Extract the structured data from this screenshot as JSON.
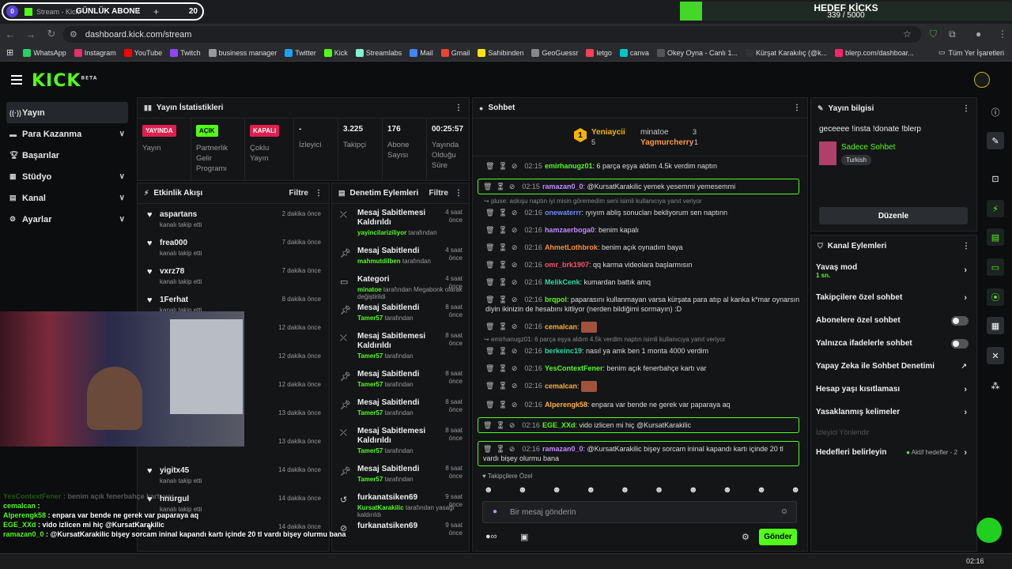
{
  "browser": {
    "tab_counter": "0",
    "tab_title": "Stream - Kick",
    "abone_label": "GÜNLÜK ABONE",
    "abone_count": "20",
    "url": "dashboard.kick.com/stream",
    "goal_title": "HEDEF KİCKS",
    "goal_value": "339 / 5000",
    "goal_progress": 0.0678,
    "bookmarks": [
      "WhatsApp",
      "Instagram",
      "YouTube",
      "Twitch",
      "business manager",
      "Twitter",
      "Kick",
      "Streamlabs",
      "Mail",
      "Gmail",
      "Sahibinden",
      "GeoGuessr",
      "letgo",
      "canva",
      "Okey Oyna - Canlı 1...",
      "Kürşat Karakılıç (@k...",
      "blerp.com/dashboar..."
    ],
    "bookmark_colors": [
      "#25d366",
      "#e1306c",
      "#ff0000",
      "#9146ff",
      "#999999",
      "#1da1f2",
      "#53fc18",
      "#80f5d2",
      "#4285f4",
      "#ea4335",
      "#ffe600",
      "#888888",
      "#ff3f55",
      "#00c4cc",
      "#555555",
      "#333333",
      "#ff2266"
    ],
    "all_bookmarks": "Tüm Yer İşaretleri"
  },
  "brand": {
    "logo": "KICK",
    "beta": "BETA",
    "accent": "#53fc18"
  },
  "sidebar": {
    "items": [
      {
        "label": "Yayın",
        "icon": "broadcast-icon"
      },
      {
        "label": "Para Kazanma",
        "icon": "money-icon"
      },
      {
        "label": "Başarılar",
        "icon": "trophy-icon"
      },
      {
        "label": "Stüdyo",
        "icon": "studio-icon"
      },
      {
        "label": "Kanal",
        "icon": "channel-icon"
      },
      {
        "label": "Ayarlar",
        "icon": "gear-icon"
      }
    ]
  },
  "stats": {
    "title": "Yayın İstatistikleri",
    "cells": [
      {
        "badge": "YAYINDA",
        "label": "Yayın"
      },
      {
        "badge": "AÇIK",
        "label": "Partnerlik Gelir Programı"
      },
      {
        "badge": "KAPALI",
        "label": "Çoklu Yayın"
      },
      {
        "value": "-",
        "label": "İzleyici"
      },
      {
        "value": "3.225",
        "label": "Takipçi"
      },
      {
        "value": "176",
        "label": "Abone Sayısı"
      },
      {
        "value": "00:25:57",
        "label": "Yayında Olduğu Süre"
      }
    ]
  },
  "activity": {
    "title": "Etkinlik Akışı",
    "filter": "Filtre",
    "items": [
      {
        "name": "aspartans",
        "sub": "kanalı takip etti",
        "time": "2 dakika önce"
      },
      {
        "name": "frea000",
        "sub": "kanalı takip etti",
        "time": "7 dakika önce"
      },
      {
        "name": "vxrz78",
        "sub": "kanalı takip etti",
        "time": "7 dakika önce"
      },
      {
        "name": "1Ferhat",
        "sub": "kanalı takip etti",
        "time": "8 dakika önce"
      },
      {
        "name": "YOU",
        "sub": "",
        "time": "12 dakika önce"
      },
      {
        "name": "",
        "sub": "",
        "time": "12 dakika önce"
      },
      {
        "name": "",
        "sub": "",
        "time": "12 dakika önce"
      },
      {
        "name": "69",
        "sub": "",
        "time": "13 dakika önce"
      },
      {
        "name": "",
        "sub": "kanalı takip etti",
        "time": "13 dakika önce"
      },
      {
        "name": "yigitx45",
        "sub": "kanalı takip etti",
        "time": "14 dakika önce"
      },
      {
        "name": "hnurgul",
        "sub": "kanalı takip etti",
        "time": "14 dakika önce"
      },
      {
        "name": "",
        "sub": "",
        "time": "14 dakika önce"
      }
    ]
  },
  "mod": {
    "title": "Denetim Eylemleri",
    "filter": "Filtre",
    "items": [
      {
        "title": "Mesaj Sabitlemesi Kaldırıldı",
        "by": "yayincilariziliyor",
        "by_suffix": "tarafından",
        "time": "4 saat önce",
        "icon": "unpin-icon"
      },
      {
        "title": "Mesaj Sabitlendi",
        "by": "mahmutdilben",
        "by_suffix": "tarafından",
        "time": "4 saat önce",
        "icon": "pin-icon"
      },
      {
        "title": "Kategori",
        "by": "minatoe",
        "by_suffix": "tarafından Megabonk olarak değiştirildi",
        "time": "4 saat önce",
        "icon": "category-icon"
      },
      {
        "title": "Mesaj Sabitlendi",
        "by": "Tamer57",
        "by_suffix": "tarafından",
        "time": "8 saat önce",
        "icon": "pin-icon"
      },
      {
        "title": "Mesaj Sabitlemesi Kaldırıldı",
        "by": "Tamer57",
        "by_suffix": "tarafından",
        "time": "8 saat önce",
        "icon": "unpin-icon"
      },
      {
        "title": "Mesaj Sabitlendi",
        "by": "Tamer57",
        "by_suffix": "tarafından",
        "time": "8 saat önce",
        "icon": "pin-icon"
      },
      {
        "title": "Mesaj Sabitlendi",
        "by": "Tamer57",
        "by_suffix": "tarafından",
        "time": "8 saat önce",
        "icon": "pin-icon"
      },
      {
        "title": "Mesaj Sabitlemesi Kaldırıldı",
        "by": "Tamer57",
        "by_suffix": "tarafından",
        "time": "8 saat önce",
        "icon": "unpin-icon"
      },
      {
        "title": "Mesaj Sabitlendi",
        "by": "Tamer57",
        "by_suffix": "tarafından",
        "time": "8 saat önce",
        "icon": "pin-icon"
      },
      {
        "title": "furkanatsiken69",
        "by": "KursatKarakilic",
        "by_suffix": "tarafından yasağı kaldırıldı",
        "time": "9 saat önce",
        "icon": "undo-icon"
      },
      {
        "title": "furkanatsiken69",
        "by": "",
        "by_suffix": "",
        "time": "9 saat önce",
        "icon": "ban-icon"
      }
    ]
  },
  "chat": {
    "title": "Sohbet",
    "leaders": [
      {
        "rank": "1",
        "name": "Yeniaycii",
        "count": "5"
      },
      {
        "name": "minatoe",
        "count": "3"
      },
      {
        "name": "Yagmurcherry",
        "count": "1"
      }
    ],
    "messages": [
      {
        "time": "02:15",
        "user": "emirhanugz01",
        "color": "#53fc18",
        "text": "6 parça eşya aldım 4.5k verdim naptın"
      },
      {
        "time": "02:15",
        "user": "ramazan0_0",
        "color": "#c48bff",
        "text": "@KursatKarakilic yemek yesemmi yemesemmi",
        "hl": true
      },
      {
        "reply": "pluse: askışu naptın iyi misin göremedim seni isimli kullanıcıya yanıt veriyor"
      },
      {
        "time": "02:16",
        "user": "onewaterrr",
        "color": "#6e8bff",
        "text": "ıyıyım abliş sonucları bekliyorum sen naptınn"
      },
      {
        "time": "02:16",
        "user": "hamzaerboga0",
        "color": "#c48bff",
        "text": "benim kapalı"
      },
      {
        "time": "02:16",
        "user": "AhmetLothbrok",
        "color": "#ff8c3a",
        "text": "benim açık oynadım baya"
      },
      {
        "time": "02:16",
        "user": "omr_brk1907",
        "color": "#ff4f6b",
        "text": "qq karma videolara başlarmısın"
      },
      {
        "time": "02:16",
        "user": "MelikCenk",
        "color": "#2fd6a0",
        "text": "kumardan battık amq"
      },
      {
        "time": "02:16",
        "user": "brqpol",
        "color": "#53fc18",
        "text": "paparasını kullanmayan varsa kürşata para atıp al kanka k*mar oynarsın diyin ikinizin de hesabını kitliyor (nerden bildiğimi sormayın) :D"
      },
      {
        "time": "02:16",
        "user": "cemalcan",
        "color": "#ffb03a",
        "text": "",
        "emote": true
      },
      {
        "reply": "emirhanugz01: 6 parça eşya aldım 4.5k verdim naptın isimli kullanıcıya yanıt veriyor"
      },
      {
        "time": "02:16",
        "user": "berkeinc19",
        "color": "#2fd6a0",
        "text": "nasıl ya amk ben 1 monta 4000 verdim"
      },
      {
        "time": "02:16",
        "user": "YesContextFener",
        "color": "#53fc18",
        "text": "benim açık fenerbahçe kartı var"
      },
      {
        "time": "02:16",
        "user": "cemalcan",
        "color": "#ffb03a",
        "text": "",
        "emote": true
      },
      {
        "time": "02:16",
        "user": "Alperengk58",
        "color": "#ffb03a",
        "text": "enpara var bende ne gerek var paparaya aq"
      },
      {
        "time": "02:16",
        "user": "EGE_XXd",
        "color": "#53fc18",
        "text": "vido izlicen mi hiç @KursatKarakilic",
        "hl": true
      },
      {
        "time": "02:16",
        "user": "ramazan0_0",
        "color": "#c48bff",
        "text": "@KursatKarakilic bişey sorcam ininal kapandı kartı içinde 20 tl vardı bişey olurmu bana",
        "hl": true
      }
    ],
    "followers_only": "Takipçilere Özel",
    "input_placeholder": "Bir mesaj gönderin",
    "send": "Gönder"
  },
  "info": {
    "title": "Yayın bilgisi",
    "stream_title": "geceeee !insta !donate !blerp",
    "category": "Sadece Sohbet",
    "language": "Turkish",
    "edit": "Düzenle"
  },
  "channel_actions": {
    "title": "Kanal Eylemleri",
    "items": [
      {
        "label": "Yavaş mod",
        "sub": "1 sn.",
        "type": "chev"
      },
      {
        "label": "Takipçilere özel sohbet",
        "type": "chev"
      },
      {
        "label": "Abonelere özel sohbet",
        "type": "toggle"
      },
      {
        "label": "Yalnızca ifadelerle sohbet",
        "type": "toggle"
      },
      {
        "label": "Yapay Zeka ile Sohbet Denetimi",
        "type": "ext"
      },
      {
        "label": "Hesap yaşı kısıtlaması",
        "type": "chev"
      },
      {
        "label": "Yasaklanmış kelimeler",
        "type": "chev"
      }
    ],
    "disabled_label": "İzleyici Yönlendir",
    "goals_label": "Hedefleri belirleyin",
    "goals_status": "Aktif hedefler - 2"
  },
  "overlay_chat": [
    {
      "user": "YesContextFener",
      "text": "benim açık fenerbahçe kartı var"
    },
    {
      "user": "cemalcan",
      "text": ""
    },
    {
      "user": "Alperengk58",
      "text": "enpara var bende ne gerek var paparaya aq"
    },
    {
      "user": "EGE_XXd",
      "text": "vido izlicen mi hiç @KursatKarakilic"
    },
    {
      "user": "ramazan0_0",
      "text": "@KursatKarakilic bişey sorcam ininal kapandı kartı içinde 20 tl vardı bişey olurmu bana"
    }
  ],
  "taskbar_time": "02:16"
}
